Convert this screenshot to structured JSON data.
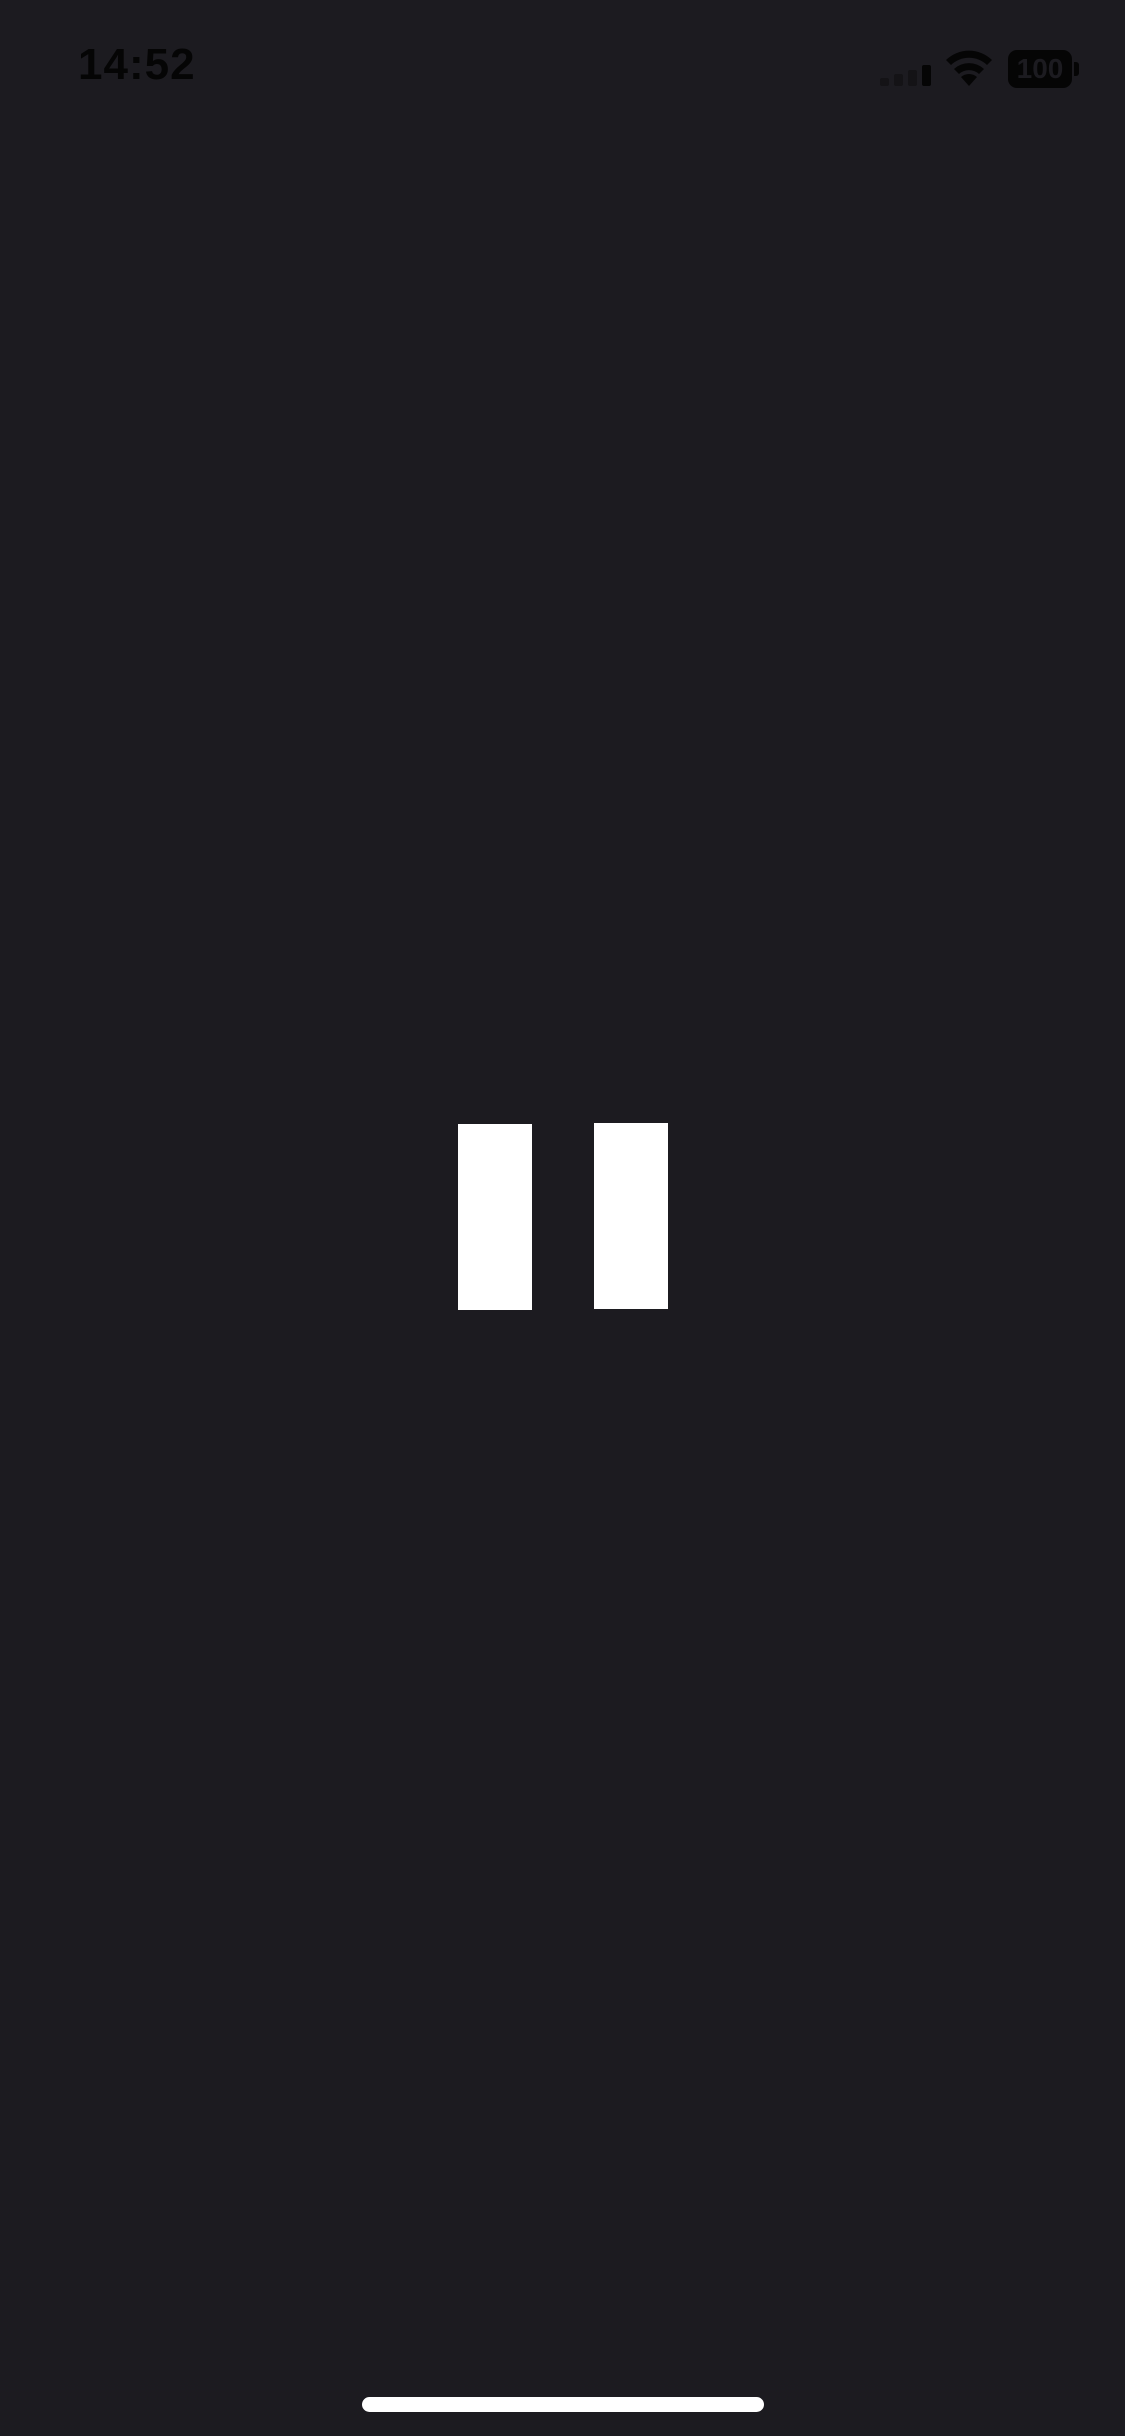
{
  "status_bar": {
    "time": "14:52",
    "battery_level": "100",
    "signal_icon": "cellular-signal-icon",
    "wifi_icon": "wifi-icon",
    "battery_icon": "battery-icon"
  },
  "player": {
    "control_icon": "pause-icon"
  },
  "colors": {
    "background": "#1c1b20",
    "foreground": "#ffffff",
    "status_text": "#050505"
  }
}
